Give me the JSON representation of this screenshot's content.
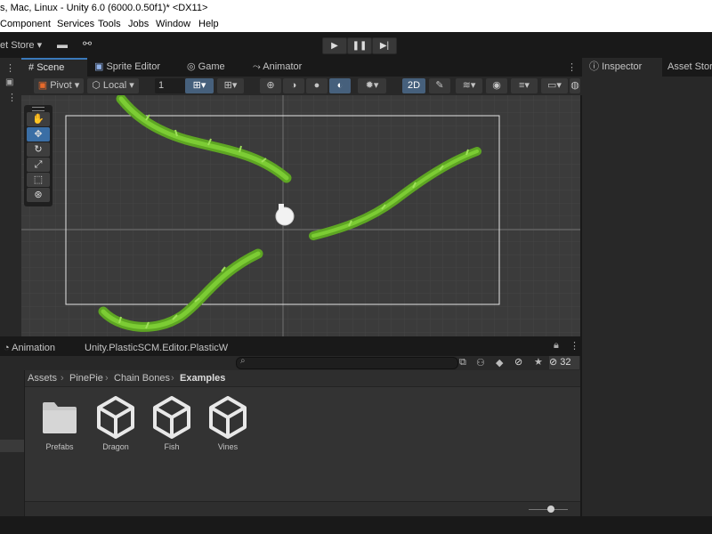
{
  "window": {
    "title": "s, Mac, Linux - Unity 6.0 (6000.0.50f1)* <DX11>"
  },
  "menu": [
    "Component",
    "Services",
    "Tools",
    "Jobs",
    "Window",
    "Help"
  ],
  "toolbar": {
    "store_label": "et Store"
  },
  "scene_tabs": [
    {
      "label": "Scene",
      "active": true
    },
    {
      "label": "Sprite Editor",
      "active": false
    },
    {
      "label": "Game",
      "active": false
    },
    {
      "label": "Animator",
      "active": false
    }
  ],
  "scene_toolbar": {
    "pivot": "Pivot",
    "local": "Local",
    "grid_value": "1",
    "mode_2d": "2D"
  },
  "right_tabs": {
    "inspector": "Inspector",
    "asset_store": "Asset Stor"
  },
  "bottom_tabs": {
    "animation": "Animation",
    "plastic": "Unity.PlasticSCM.Editor.PlasticW"
  },
  "project": {
    "hidden_count": "32",
    "breadcrumb": [
      "Assets",
      "PinePie",
      "Chain Bones",
      "Examples"
    ],
    "assets": [
      {
        "name": "Prefabs",
        "kind": "folder"
      },
      {
        "name": "Dragon",
        "kind": "unity"
      },
      {
        "name": "Fish",
        "kind": "unity"
      },
      {
        "name": "Vines",
        "kind": "unity"
      }
    ]
  },
  "colors": {
    "accent": "#3a79bb",
    "vine": "#6fbf2a",
    "scene_bg": "#3b3b3b"
  }
}
